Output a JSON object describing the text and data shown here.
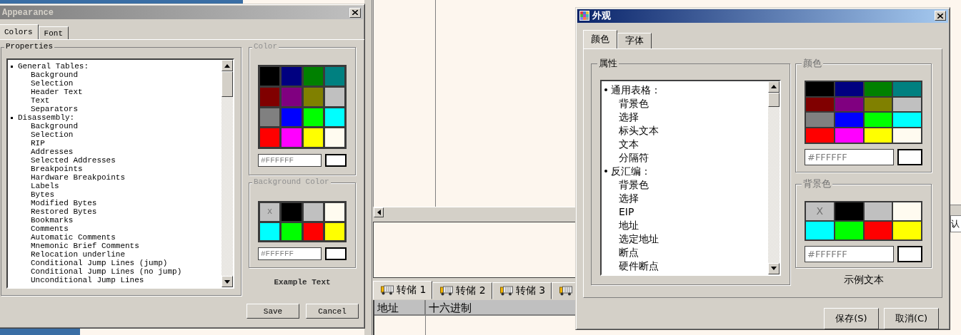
{
  "left_dialog": {
    "title": "Appearance",
    "tabs": [
      {
        "label": "Colors",
        "selected": true
      },
      {
        "label": "Font",
        "selected": false
      }
    ],
    "properties_group": "Properties",
    "property_list": [
      {
        "label": "General Tables:",
        "children": [
          {
            "label": "Background"
          },
          {
            "label": "Selection"
          },
          {
            "label": "Header Text"
          },
          {
            "label": "Text"
          },
          {
            "label": "Separators"
          }
        ]
      },
      {
        "label": "Disassembly:",
        "children": [
          {
            "label": "Background"
          },
          {
            "label": "Selection"
          },
          {
            "label": "RIP"
          },
          {
            "label": "Addresses"
          },
          {
            "label": "Selected Addresses"
          },
          {
            "label": "Breakpoints"
          },
          {
            "label": "Hardware Breakpoints"
          },
          {
            "label": "Labels"
          },
          {
            "label": "Bytes"
          },
          {
            "label": "Modified Bytes"
          },
          {
            "label": "Restored Bytes"
          },
          {
            "label": "Bookmarks"
          },
          {
            "label": "Comments"
          },
          {
            "label": "Automatic Comments"
          },
          {
            "label": "Mnemonic Brief Comments"
          },
          {
            "label": "Relocation underline"
          },
          {
            "label": "Conditional Jump Lines (jump)"
          },
          {
            "label": "Conditional Jump Lines (no jump)"
          },
          {
            "label": "Unconditional Jump Lines"
          }
        ]
      }
    ],
    "color_group": {
      "title": "Color",
      "swatches": [
        {
          "color": "#000000"
        },
        {
          "color": "#000080"
        },
        {
          "color": "#008000"
        },
        {
          "color": "#008080"
        },
        {
          "color": "#800000"
        },
        {
          "color": "#800080"
        },
        {
          "color": "#808000"
        },
        {
          "color": "#c0c0c0"
        },
        {
          "color": "#808080"
        },
        {
          "color": "#0000ff"
        },
        {
          "color": "#00ff00"
        },
        {
          "color": "#00ffff"
        },
        {
          "color": "#ff0000"
        },
        {
          "color": "#ff00ff"
        },
        {
          "color": "#ffff00"
        },
        {
          "color": "#fffbf0"
        }
      ],
      "hex_value": "#FFFFFF"
    },
    "background_color_group": {
      "title": "Background Color",
      "swatches": [
        {
          "color": "#c0c0c0",
          "label": "X"
        },
        {
          "color": "#000000"
        },
        {
          "color": "#c0c0c0"
        },
        {
          "color": "#fffbf0"
        },
        {
          "color": "#00ffff"
        },
        {
          "color": "#00ff00"
        },
        {
          "color": "#ff0000"
        },
        {
          "color": "#ffff00"
        }
      ],
      "hex_value": "#FFFFFF"
    },
    "example_text": "Example Text",
    "buttons": [
      "Save",
      "Cancel"
    ]
  },
  "right_dialog": {
    "title": "外观",
    "tabs": [
      {
        "label": "颜色",
        "selected": true
      },
      {
        "label": "字体",
        "selected": false
      }
    ],
    "properties_group": "属性",
    "property_list": [
      {
        "label": "通用表格：",
        "children": [
          {
            "label": "背景色"
          },
          {
            "label": "选择"
          },
          {
            "label": "标头文本"
          },
          {
            "label": "文本"
          },
          {
            "label": "分隔符"
          }
        ]
      },
      {
        "label": "反汇编：",
        "children": [
          {
            "label": "背景色"
          },
          {
            "label": "选择"
          },
          {
            "label": "EIP"
          },
          {
            "label": "地址"
          },
          {
            "label": "选定地址"
          },
          {
            "label": "断点"
          },
          {
            "label": "硬件断点"
          }
        ]
      }
    ],
    "color_group": {
      "title": "颜色",
      "swatches": [
        {
          "color": "#000000"
        },
        {
          "color": "#000080"
        },
        {
          "color": "#008000"
        },
        {
          "color": "#008080"
        },
        {
          "color": "#800000"
        },
        {
          "color": "#800080"
        },
        {
          "color": "#808000"
        },
        {
          "color": "#c0c0c0"
        },
        {
          "color": "#808080"
        },
        {
          "color": "#0000ff"
        },
        {
          "color": "#00ff00"
        },
        {
          "color": "#00ffff"
        },
        {
          "color": "#ff0000"
        },
        {
          "color": "#ff00ff"
        },
        {
          "color": "#ffff00"
        },
        {
          "color": "#fffbf0"
        }
      ],
      "hex_value": "#FFFFFF"
    },
    "background_color_group": {
      "title": "背景色",
      "swatches": [
        {
          "color": "#c0c0c0",
          "label": "X"
        },
        {
          "color": "#000000"
        },
        {
          "color": "#c0c0c0"
        },
        {
          "color": "#fffbf0"
        },
        {
          "color": "#00ffff"
        },
        {
          "color": "#00ff00"
        },
        {
          "color": "#ff0000"
        },
        {
          "color": "#ffff00"
        }
      ],
      "hex_value": "#FFFFFF"
    },
    "example_text": "示例文本",
    "buttons": [
      "保存(S)",
      "取消(C)"
    ]
  },
  "dump_tabs": [
    {
      "label": "转储 1",
      "selected": true
    },
    {
      "label": "转储 2",
      "selected": false
    },
    {
      "label": "转储 3",
      "selected": false
    },
    {
      "selected": false
    }
  ],
  "dump_table": {
    "columns": [
      "地址",
      "十六进制"
    ]
  },
  "side_button": {
    "label": "认"
  }
}
